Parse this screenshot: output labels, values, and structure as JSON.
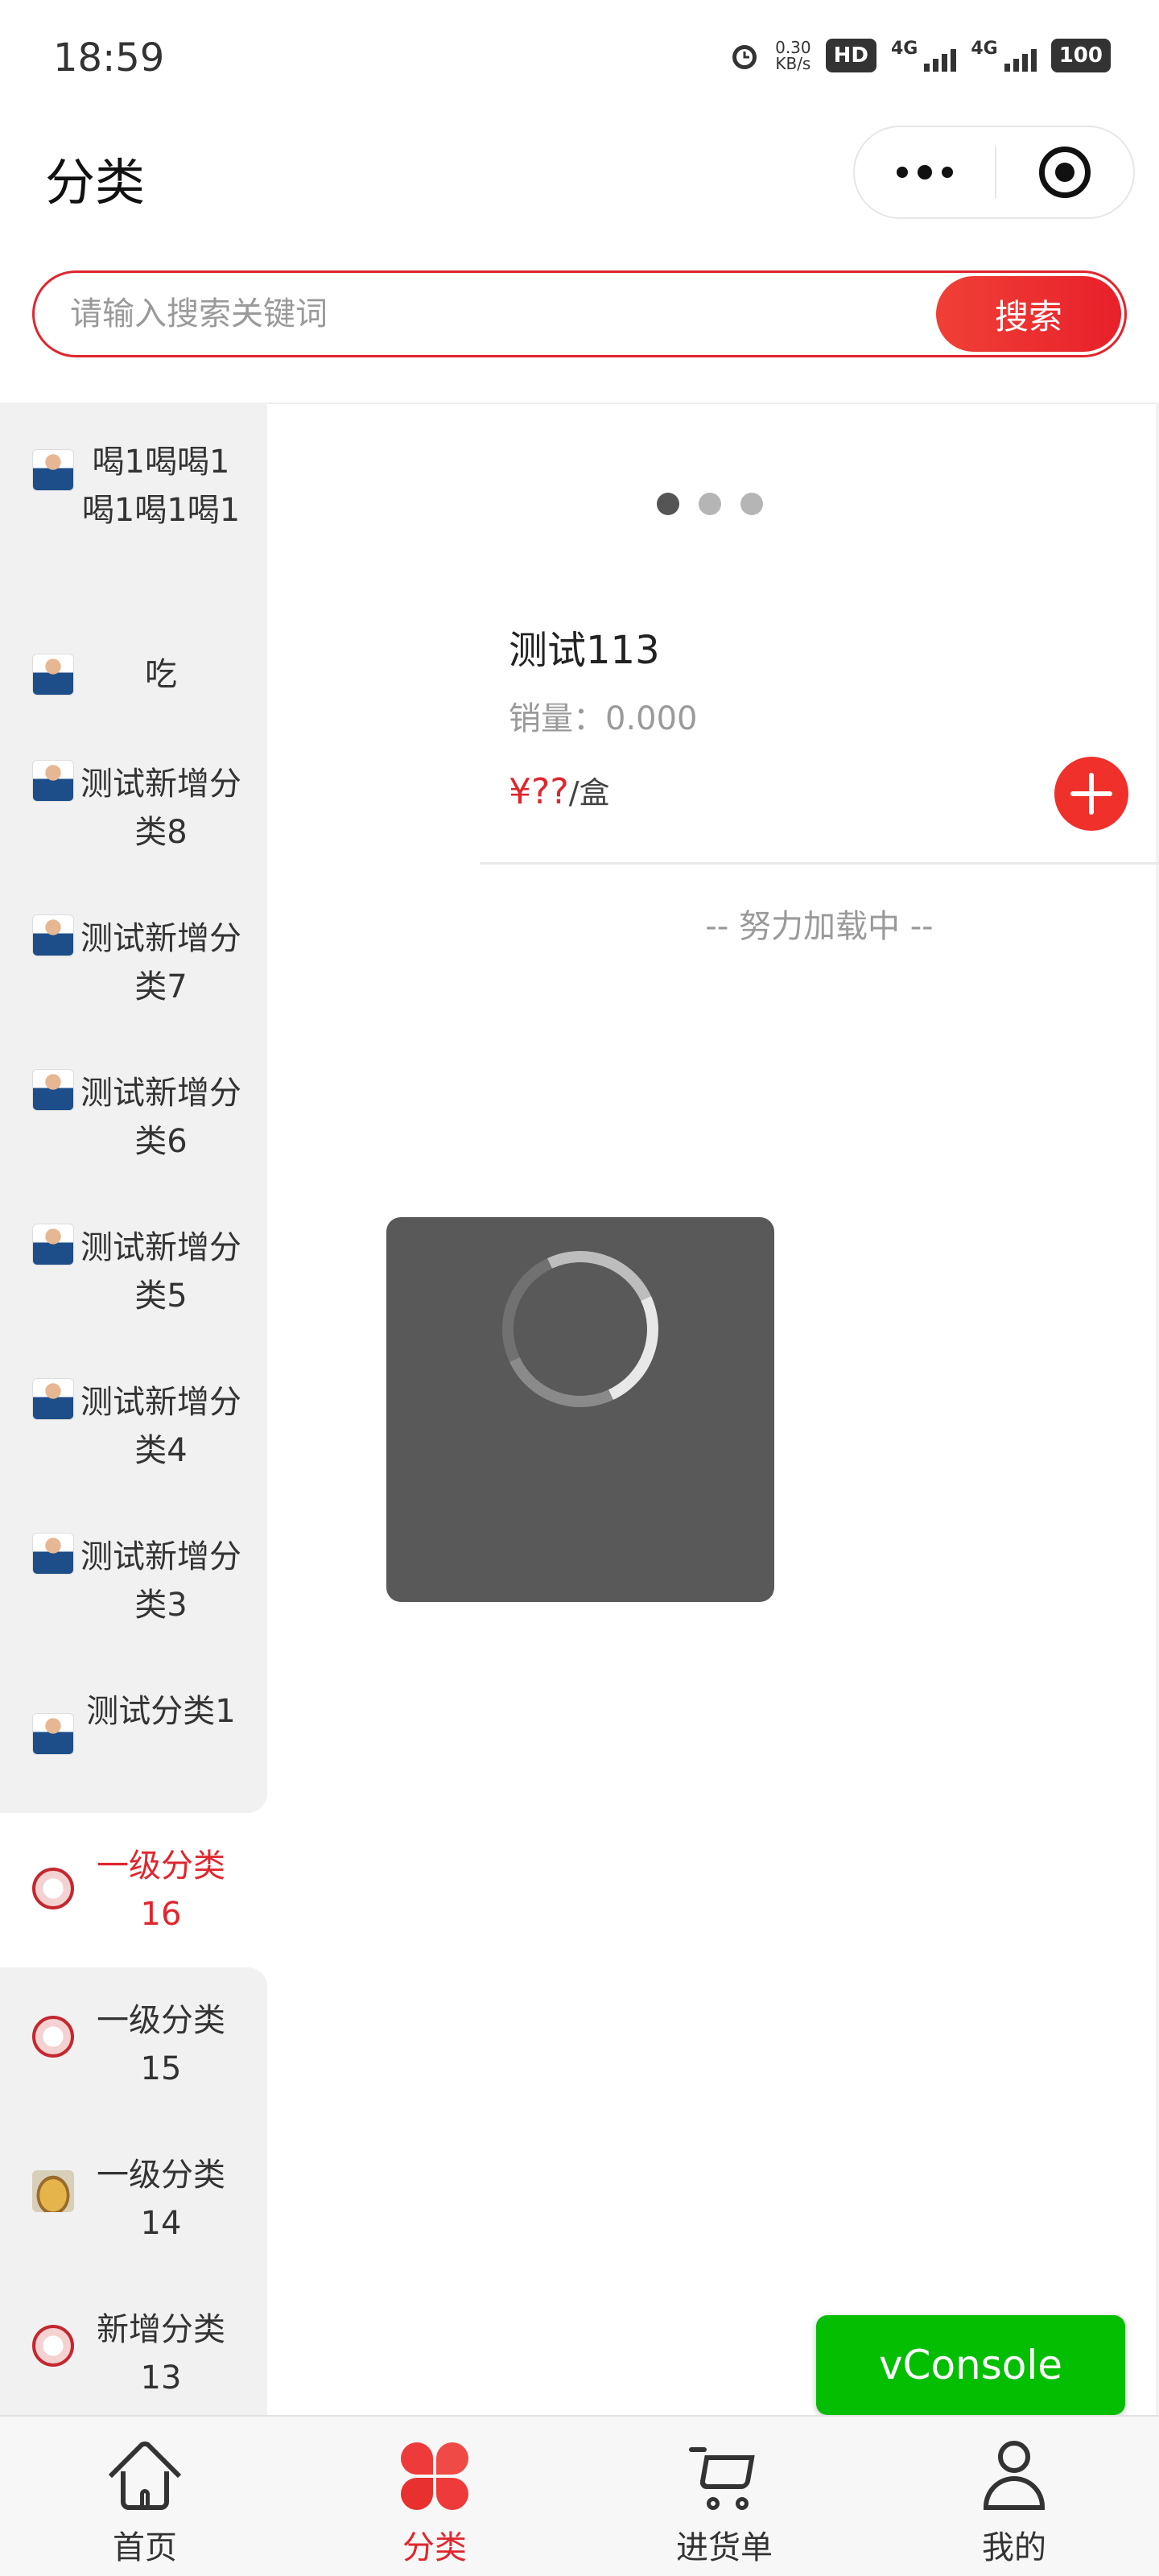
{
  "status_bar": {
    "time": "18:59",
    "speed_value": "0.30",
    "speed_unit": "KB/s",
    "hd_label": "HD",
    "network_1": "4G",
    "network_2": "4G",
    "battery": "100"
  },
  "header": {
    "title": "分类",
    "more_icon": "more-dots-icon",
    "close_icon": "target-circle-icon"
  },
  "search": {
    "placeholder": "请输入搜索关键词",
    "value": "",
    "button_label": "搜索",
    "accent_color": "#e0262d"
  },
  "sidebar": {
    "items": [
      {
        "label": "喝1喝喝1喝1喝1喝1",
        "icon": "person-thumbnail-icon"
      },
      {
        "label": "吃",
        "icon": "person-thumbnail-icon"
      },
      {
        "label": "测试新增分类8",
        "icon": "person-thumbnail-icon"
      },
      {
        "label": "测试新增分类7",
        "icon": "person-thumbnail-icon"
      },
      {
        "label": "测试新增分类6",
        "icon": "person-thumbnail-icon"
      },
      {
        "label": "测试新增分类5",
        "icon": "person-thumbnail-icon"
      },
      {
        "label": "测试新增分类4",
        "icon": "person-thumbnail-icon"
      },
      {
        "label": "测试新增分类3",
        "icon": "person-thumbnail-icon"
      },
      {
        "label": "测试分类1",
        "icon": "person-thumbnail-icon"
      },
      {
        "label": "一级分类16",
        "icon": "seal-thumbnail-icon",
        "active": true
      },
      {
        "label": "一级分类15",
        "icon": "seal-thumbnail-icon"
      },
      {
        "label": "一级分类14",
        "icon": "food-thumbnail-icon"
      },
      {
        "label": "新增分类13",
        "icon": "seal-thumbnail-icon"
      }
    ]
  },
  "content": {
    "carousel_dots": 3,
    "carousel_active_index": 0,
    "product": {
      "name": "测试113",
      "sales": "销量：0.000",
      "price": "¥??",
      "unit": "/盒",
      "add_icon": "plus-circle-icon"
    },
    "loading_more": "-- 努力加载中 --"
  },
  "loading_toast": {
    "icon": "loading-spinner-icon"
  },
  "vconsole": {
    "label": "vConsole",
    "color": "#04be02"
  },
  "tab_bar": {
    "tabs": [
      {
        "label": "首页",
        "icon": "home-icon"
      },
      {
        "label": "分类",
        "icon": "category-petals-icon",
        "active": true
      },
      {
        "label": "进货单",
        "icon": "cart-icon"
      },
      {
        "label": "我的",
        "icon": "user-icon"
      }
    ]
  }
}
